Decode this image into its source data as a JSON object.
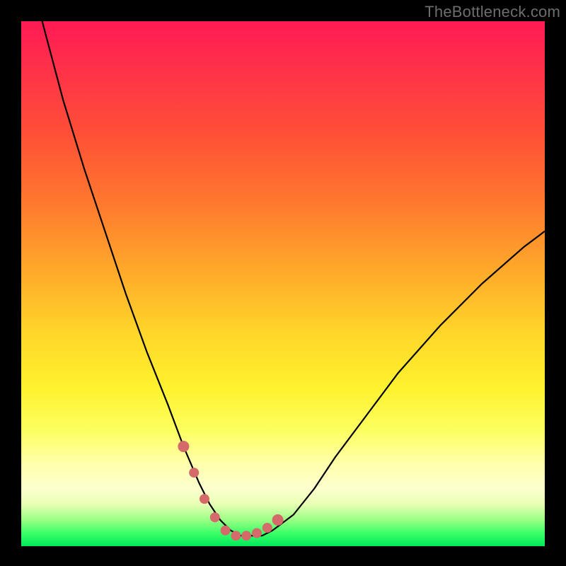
{
  "watermark": "TheBottleneck.com",
  "colors": {
    "curve_stroke": "#000000",
    "marker_fill": "#d46a6a",
    "background_frame": "#000000"
  },
  "chart_data": {
    "type": "line",
    "title": "",
    "xlabel": "",
    "ylabel": "",
    "xlim": [
      0,
      100
    ],
    "ylim": [
      0,
      100
    ],
    "grid": false,
    "legend": false,
    "annotations": [],
    "series": [
      {
        "name": "bottleneck-curve",
        "x": [
          4,
          8,
          12,
          16,
          20,
          24,
          28,
          31,
          34,
          36,
          38,
          40,
          42,
          44,
          46,
          48,
          52,
          56,
          60,
          66,
          72,
          80,
          88,
          96,
          100
        ],
        "y": [
          100,
          85,
          72,
          60,
          48,
          37,
          27,
          19,
          12,
          8,
          5,
          3,
          2,
          2,
          2,
          3,
          6,
          11,
          17,
          25,
          33,
          42,
          50,
          57,
          60
        ]
      }
    ],
    "markers": {
      "name": "highlight-points",
      "x": [
        31,
        33,
        35,
        37,
        39,
        41,
        43,
        45,
        47,
        49
      ],
      "y": [
        19,
        14,
        9,
        5.5,
        3,
        2,
        2,
        2.5,
        3.5,
        5
      ]
    }
  }
}
